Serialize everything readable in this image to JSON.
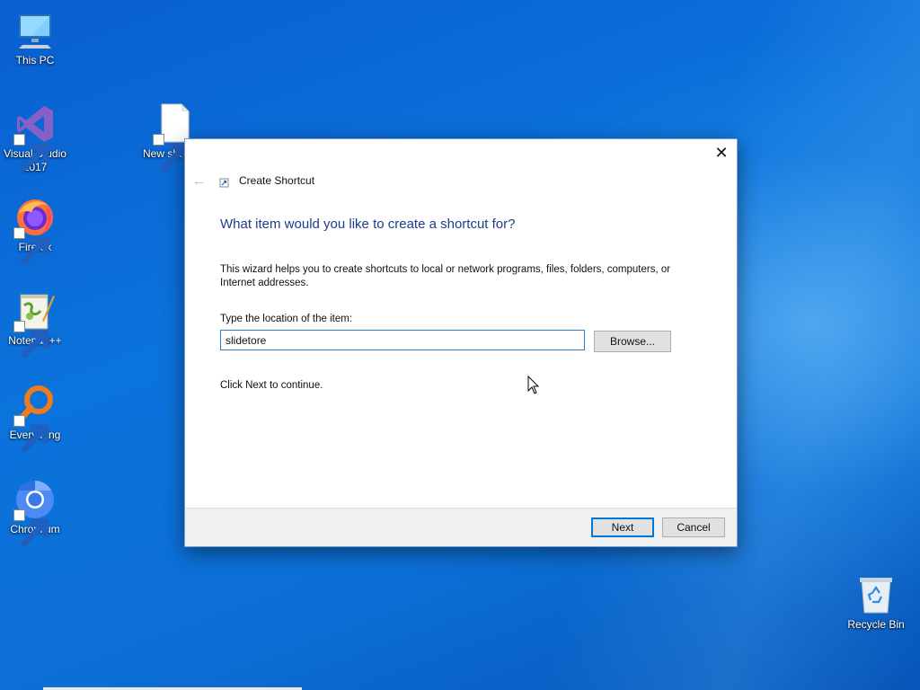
{
  "desktop": {
    "icons": [
      {
        "label": "This PC",
        "icon": "computer-icon"
      },
      {
        "label": "Visual Studio 2017",
        "icon": "visual-studio-icon"
      },
      {
        "label": "Firefox",
        "icon": "firefox-icon"
      },
      {
        "label": "Notepad++",
        "icon": "notepad-plus-plus-icon"
      },
      {
        "label": "Everything",
        "icon": "everything-search-icon"
      },
      {
        "label": "Chromium",
        "icon": "chromium-icon"
      },
      {
        "label": "New sho",
        "icon": "blank-file-icon"
      },
      {
        "label": "Recycle Bin",
        "icon": "recycle-bin-icon"
      }
    ]
  },
  "dialog": {
    "close_label": "✕",
    "back_label": "←",
    "title": "Create Shortcut",
    "heading": "What item would you like to create a shortcut for?",
    "description": "This wizard helps you to create shortcuts to local or network programs, files, folders, computers, or Internet addresses.",
    "location_label": "Type the location of the item:",
    "location_value": "slidetore",
    "browse_label": "Browse...",
    "continue_text": "Click Next to continue.",
    "next_label": "Next",
    "cancel_label": "Cancel"
  },
  "colors": {
    "heading": "#1f3b8a",
    "accent": "#0078d7",
    "desktop": "#0b73dc"
  }
}
